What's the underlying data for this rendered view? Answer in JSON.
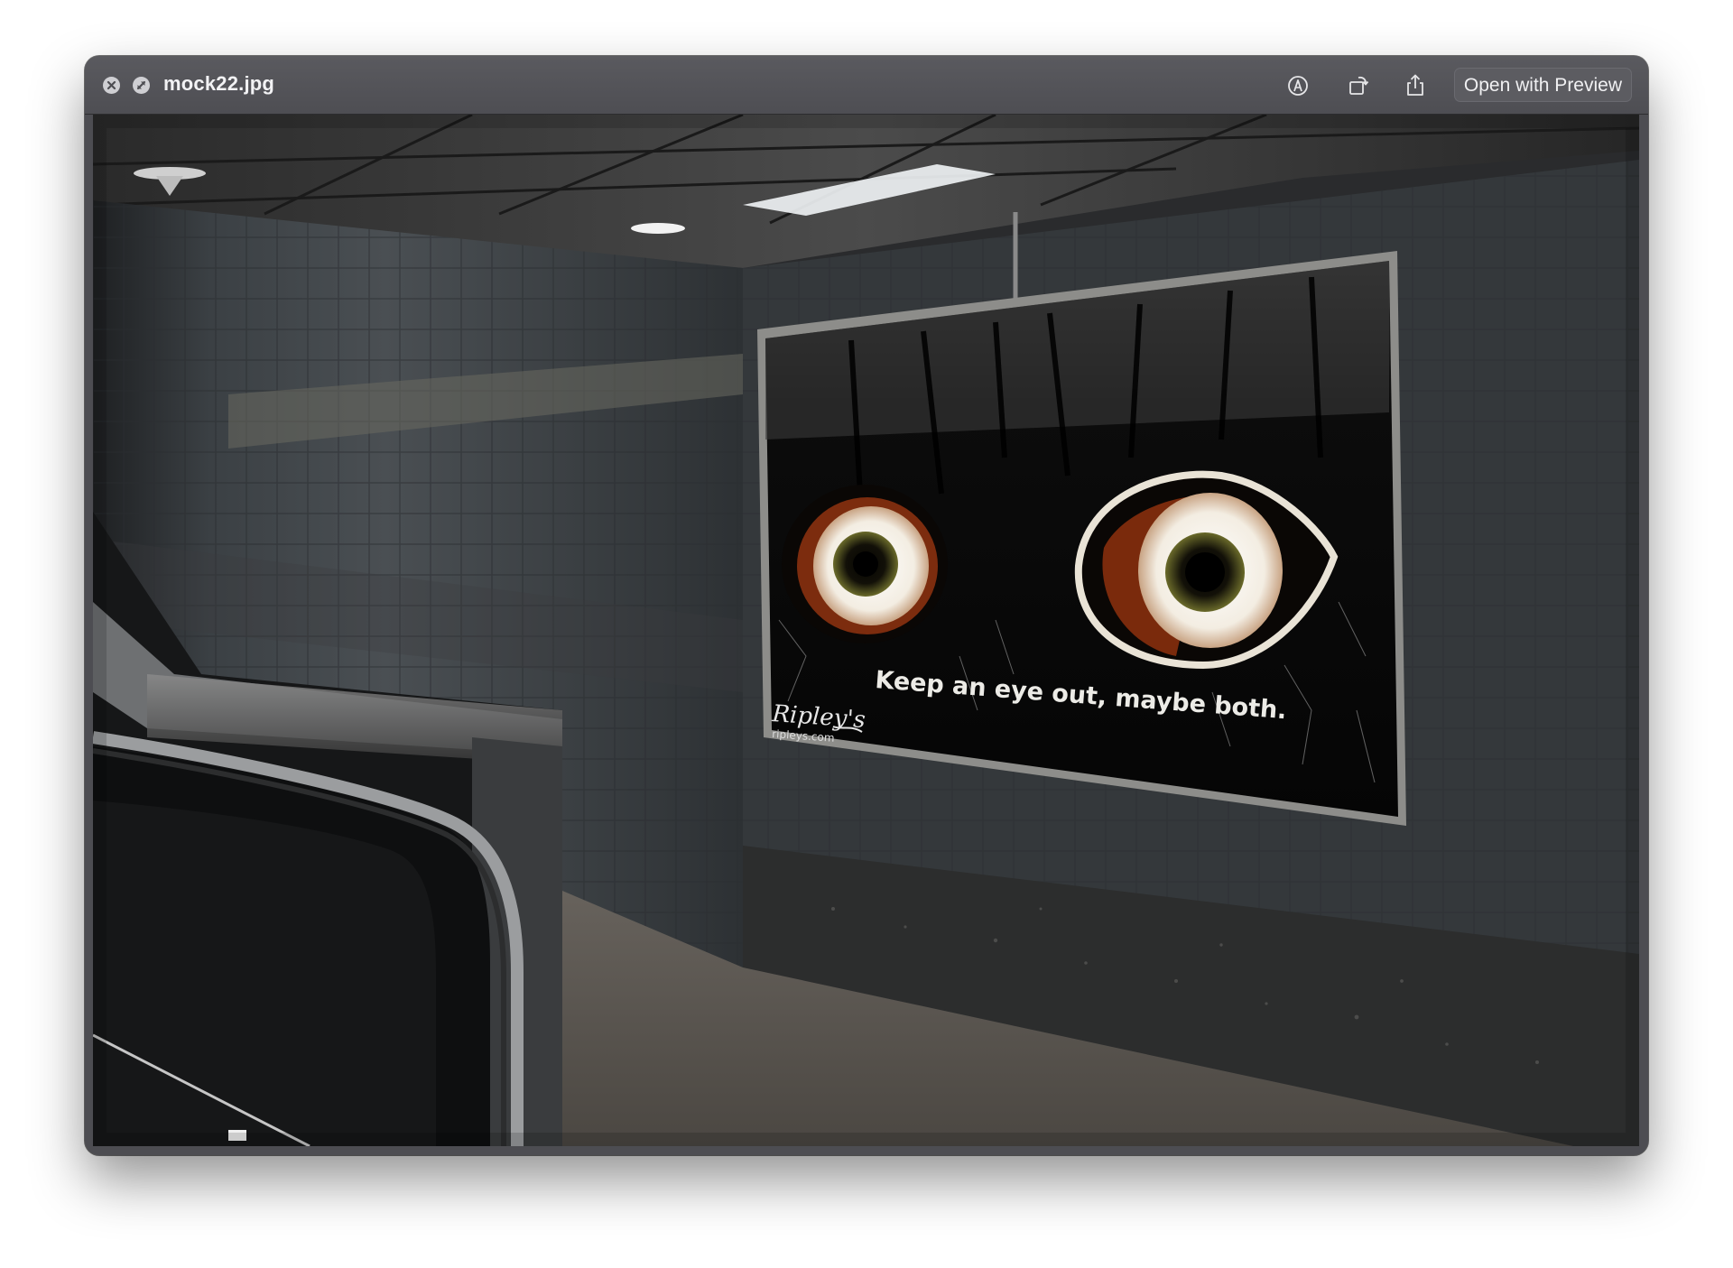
{
  "window": {
    "filename": "mock22.jpg"
  },
  "toolbar": {
    "markup_icon": "markup-pen-icon",
    "rotate_icon": "rotate-icon",
    "share_icon": "share-icon",
    "open_with_label": "Open with Preview"
  },
  "image": {
    "scene": "subway-corridor-billboard",
    "billboard": {
      "slogan": "Keep an eye out, maybe both.",
      "brand": "Ripley's",
      "url": "ripleys.com"
    }
  },
  "colors": {
    "titlebar": "#515156",
    "accent_text": "#f2f2f4"
  }
}
